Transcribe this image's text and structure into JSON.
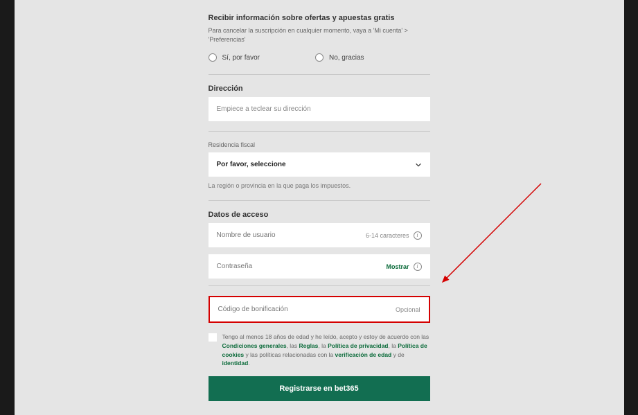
{
  "offers": {
    "title": "Recibir información sobre ofertas y apuestas gratis",
    "sub": "Para cancelar la suscripción en cualquier momento, vaya a 'Mi cuenta' > 'Preferencias'",
    "yes": "Sí, por favor",
    "no": "No, gracias"
  },
  "address": {
    "title": "Dirección",
    "placeholder": "Empiece a teclear su dirección"
  },
  "fiscal": {
    "label": "Residencia fiscal",
    "selected": "Por favor, seleccione",
    "helper": "La región o provincia en la que paga los impuestos."
  },
  "access": {
    "title": "Datos de acceso",
    "username_ph": "Nombre de usuario",
    "username_hint": "6-14 caracteres",
    "password_ph": "Contraseña",
    "password_show": "Mostrar"
  },
  "bonus": {
    "placeholder": "Código de bonificación",
    "optional": "Opcional"
  },
  "terms": {
    "t1": "Tengo al menos 18 años de edad y he leído, acepto y estoy de acuerdo con las ",
    "l1": "Condiciones generales",
    "t2": ", las ",
    "l2": "Reglas",
    "t3": ", la ",
    "l3": "Política de privacidad",
    "t4": ", la ",
    "l4": "Política de cookies",
    "t5": " y las políticas relacionadas con la ",
    "l5": "verificación de edad",
    "t6": " y de ",
    "l6": "identidad",
    "t7": "."
  },
  "submit": "Registrarse en bet365"
}
